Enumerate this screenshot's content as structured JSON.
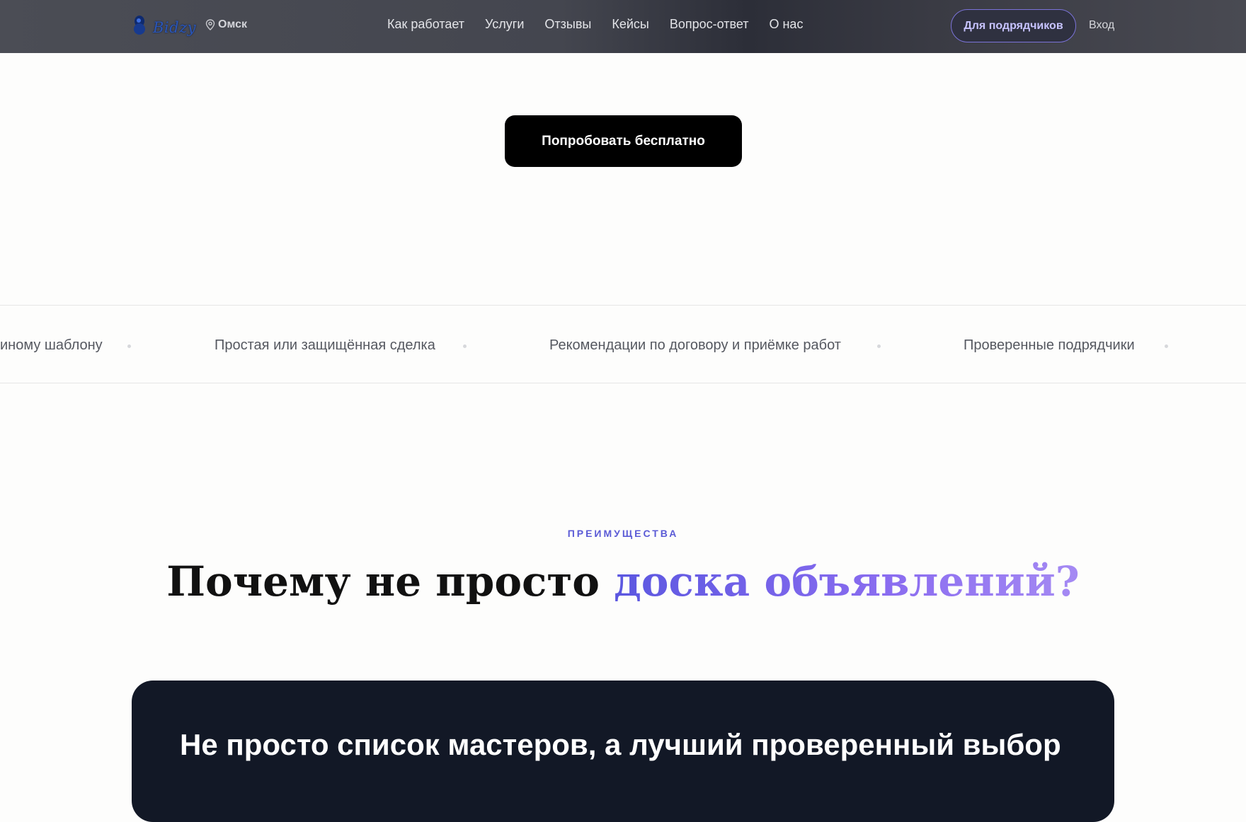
{
  "header": {
    "logo_text": "Bidzy",
    "city": "Омск",
    "nav": [
      "Как работает",
      "Услуги",
      "Отзывы",
      "Кейсы",
      "Вопрос-ответ",
      "О нас"
    ],
    "contractors_button": "Для подрядчиков",
    "login": "Вход"
  },
  "hero": {
    "cta_label": "Попробовать бесплатно"
  },
  "ticker": {
    "items": [
      "иному шаблону",
      "Простая или защищённая сделка",
      "Рекомендации по договору и приёмке работ",
      "Проверенные подрядчики"
    ]
  },
  "advantages": {
    "eyebrow": "ПРЕИМУЩЕСТВА",
    "heading_plain": "Почему не просто ",
    "heading_accent": "доска объявлений?"
  },
  "card": {
    "title": "Не просто список мастеров, а лучший проверенный выбор"
  },
  "colors": {
    "accent": "#5b5bd6",
    "card_bg": "#121826",
    "cta_bg": "#000000"
  }
}
